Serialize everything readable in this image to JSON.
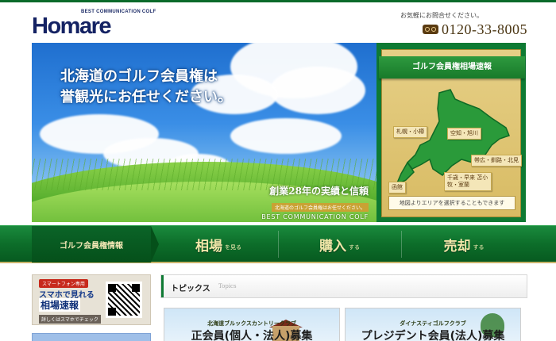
{
  "header": {
    "logo_tagline": "BEST COMMUNICATION COLF",
    "logo_word": "Homare",
    "contact_note": "お気軽にお問合せください。",
    "phone": "0120-33-8005",
    "phone_icon": "freedial-icon"
  },
  "hero": {
    "title_line1": "北海道のゴルフ会員権は",
    "title_line2": "誉観光にお任せください。",
    "sub_main": "創業28年の実績と信頼",
    "sub_small": "北海道のゴルフ会員権はお任せください。",
    "sub_en": "BEST COMMUNICATION COLF"
  },
  "map_panel": {
    "ribbon": "ゴルフ会員権相場速報",
    "areas": [
      "札幌・小樽",
      "空知・旭川",
      "帯広・釧路・北見",
      "千歳・早来 苫小牧・室蘭",
      "函館"
    ],
    "note": "地図よりエリアを選択することもできます",
    "map_color": "#2a9a3a"
  },
  "nav": {
    "item1": "ゴルフ会員権情報",
    "item2_main": "相場",
    "item2_small": "を見る",
    "item3_main": "購入",
    "item3_small": "する",
    "item4_main": "売却",
    "item4_small": "する"
  },
  "side_banner": {
    "tag": "スマートフォン専用",
    "line1": "スマホで見れる",
    "line2": "相場速報",
    "line3": "詳しくはスマホでチェック"
  },
  "topics": {
    "title": "トピックス",
    "title_en": "Topics"
  },
  "cards": [
    {
      "top": "北海道ブルックスカントリークラブ",
      "main": "正会員(個人・法人)募集"
    },
    {
      "top": "ダイナスティゴルフクラブ",
      "main": "プレジデント会員(法人)募集"
    }
  ],
  "colors": {
    "brand_green": "#0d6e2a",
    "gold": "#d8bb63",
    "logo_navy": "#142263"
  }
}
